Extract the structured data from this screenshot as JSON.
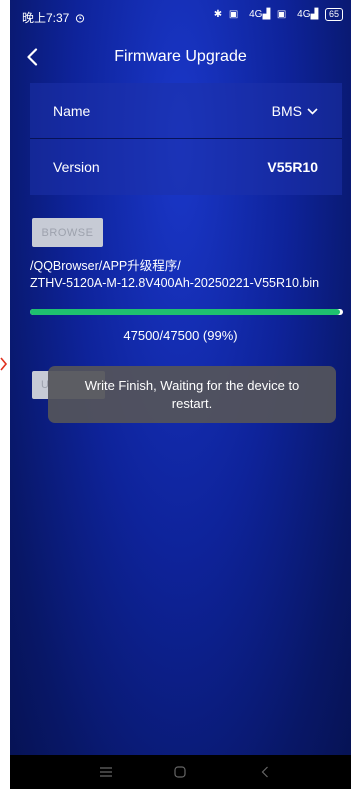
{
  "status_bar": {
    "time": "晚上7:37",
    "alarm_icon": "alarm-icon",
    "signal_text_1": "4G",
    "signal_text_2": "4G",
    "battery": "65"
  },
  "header": {
    "title": "Firmware Upgrade"
  },
  "info": {
    "name_label": "Name",
    "name_value": "BMS",
    "version_label": "Version",
    "version_value": "V55R10"
  },
  "browse": {
    "label": "BROWSE"
  },
  "file_path": "/QQBrowser/APP升级程序/\nZTHV-5120A-M-12.8V400Ah-20250221-V55R10.bin",
  "progress": {
    "fraction": 0.99,
    "text": "47500/47500 (99%)"
  },
  "upgrade_button": {
    "label": "U"
  },
  "toast": {
    "message": "Write Finish, Waiting for the device to restart."
  },
  "colors": {
    "accent_green": "#1fc16f",
    "background_blue": "#0e239a"
  }
}
